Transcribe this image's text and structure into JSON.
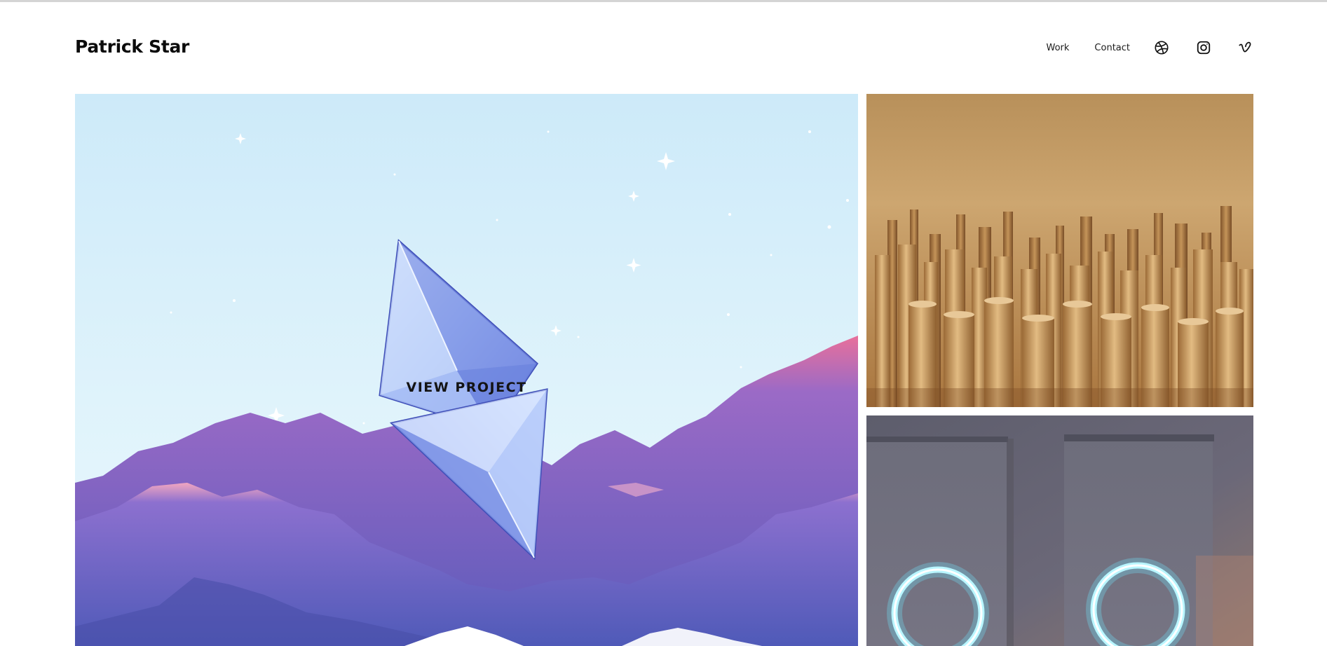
{
  "site": {
    "title": "Patrick Star"
  },
  "nav": {
    "links": [
      {
        "label": "Work"
      },
      {
        "label": "Contact"
      }
    ],
    "social": [
      {
        "icon": "dribbble-icon"
      },
      {
        "icon": "instagram-icon"
      },
      {
        "icon": "vimeo-icon"
      }
    ]
  },
  "projects": {
    "featured": {
      "overlay_label": "VIEW PROJECT",
      "scene": "glass-diamond-over-pink-purple-mountains"
    },
    "items": [
      {
        "scene": "golden-cylinders-with-letters"
      },
      {
        "scene": "neon-rings-gray-room"
      }
    ]
  },
  "colors": {
    "background": "#ffffff",
    "text": "#111111",
    "sky": "#d3eefa",
    "mountains": "#6a5fc2",
    "gold": "#c79a5a",
    "neon": "#9ff1ff"
  }
}
